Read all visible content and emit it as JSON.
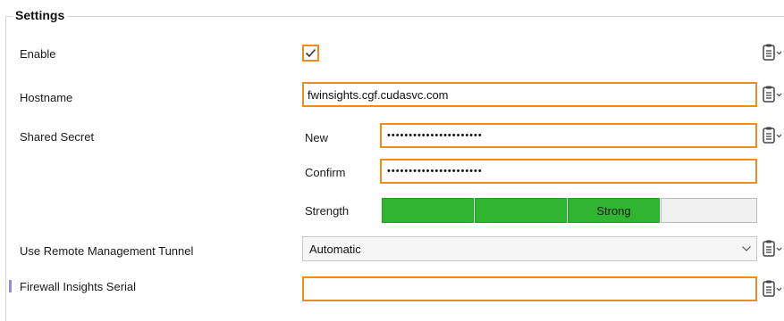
{
  "group": {
    "title": "Settings"
  },
  "enable": {
    "label": "Enable",
    "checked": true
  },
  "hostname": {
    "label": "Hostname",
    "value": "fwinsights.cgf.cudasvc.com"
  },
  "shared_secret": {
    "label": "Shared Secret",
    "new_label": "New",
    "new_value": "••••••••••••••••••••••",
    "confirm_label": "Confirm",
    "confirm_value": "••••••••••••••••••••••",
    "strength_label": "Strength",
    "strength_text": "Strong",
    "strength_level": 0.75
  },
  "tunnel": {
    "label": "Use Remote Management Tunnel",
    "selected": "Automatic"
  },
  "serial": {
    "label": "Firewall Insights Serial",
    "value": ""
  },
  "colors": {
    "focus_border": "#f08c1e",
    "strength_on": "#2fb52f",
    "strength_off": "#f0f0f0"
  },
  "icons": {
    "row_menu": "clipboard-menu-icon",
    "checkbox": "checkmark-icon",
    "dropdown": "chevron-down-icon"
  }
}
